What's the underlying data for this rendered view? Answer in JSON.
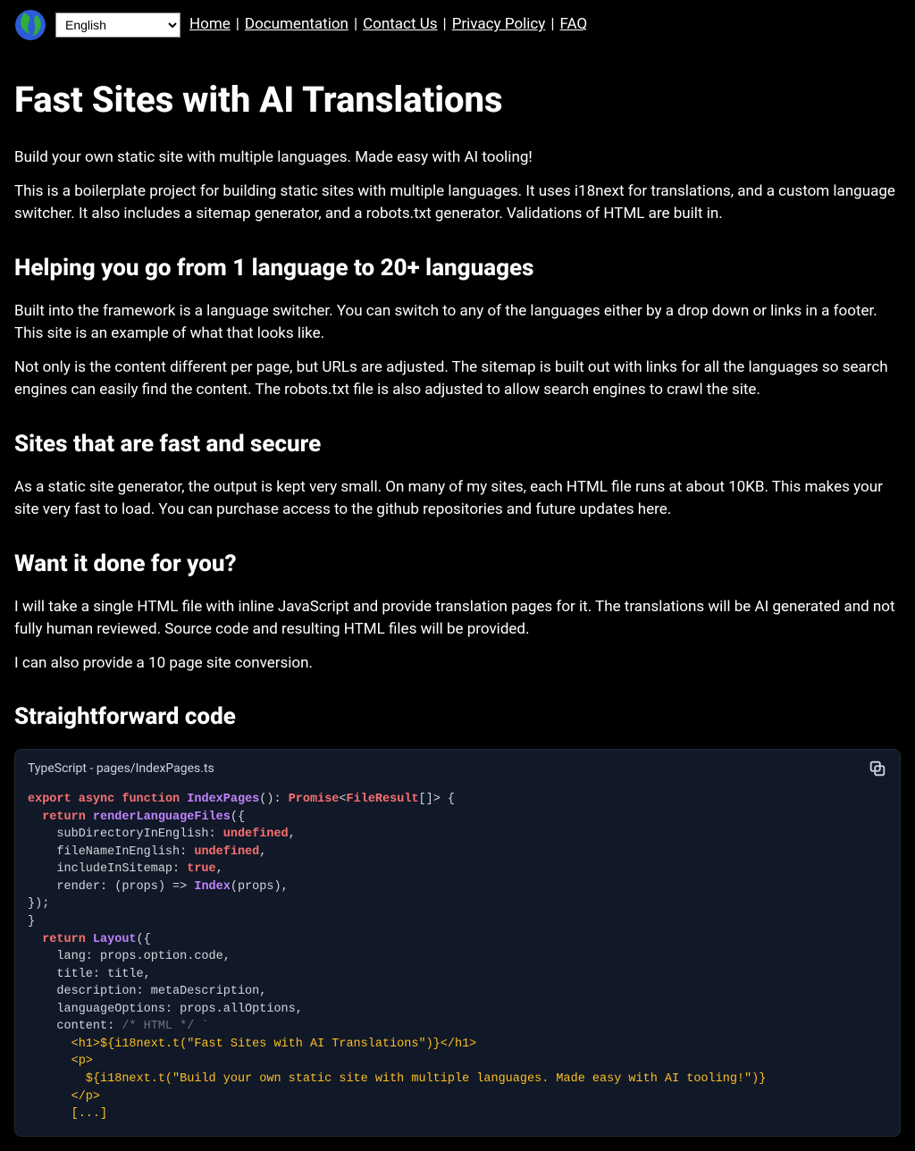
{
  "header": {
    "language_select": {
      "selected": "English"
    },
    "nav": {
      "home": "Home",
      "docs": "Documentation",
      "contact": "Contact Us",
      "privacy": "Privacy Policy",
      "faq": "FAQ"
    }
  },
  "main": {
    "title": "Fast Sites with AI Translations",
    "intro1": "Build your own static site with multiple languages. Made easy with AI tooling!",
    "intro2": "This is a boilerplate project for building static sites with multiple languages. It uses i18next for translations, and a custom language switcher. It also includes a sitemap generator, and a robots.txt generator. Validations of HTML are built in.",
    "h2_1": "Helping you go from 1 language to 20+ languages",
    "p1_1": "Built into the framework is a language switcher. You can switch to any of the languages either by a drop down or links in a footer. This site is an example of what that looks like.",
    "p1_2": "Not only is the content different per page, but URLs are adjusted. The sitemap is built out with links for all the languages so search engines can easily find the content. The robots.txt file is also adjusted to allow search engines to crawl the site.",
    "h2_2": "Sites that are fast and secure",
    "p2_1": "As a static site generator, the output is kept very small. On many of my sites, each HTML file runs at about 10KB. This makes your site very fast to load. You can purchase access to the github repositories and future updates here.",
    "h2_3": "Want it done for you?",
    "p3_1": "I will take a single HTML file with inline JavaScript and provide translation pages for it. The translations will be AI generated and not fully human reviewed. Source code and resulting HTML files will be provided.",
    "p3_2": "I can also provide a 10 page site conversion.",
    "h2_4": "Straightforward code"
  },
  "code": {
    "label": "TypeScript - pages/IndexPages.ts",
    "l1_kw1": "export",
    "l1_kw2": "async",
    "l1_kw3": "function",
    "l1_fn": "IndexPages",
    "l1_rest1": "(): ",
    "l1_typ1": "Promise",
    "l1_ang1": "<",
    "l1_typ2": "FileResult",
    "l1_rest2": "[]> {",
    "l2_kw": "return",
    "l2_fn": "renderLanguageFiles",
    "l2_rest": "({",
    "l3_a": "    subDirectoryInEnglish: ",
    "l3_val": "undefined",
    "l3_b": ",",
    "l4_a": "    fileNameInEnglish: ",
    "l4_val": "undefined",
    "l4_b": ",",
    "l5_a": "    includeInSitemap: ",
    "l5_val": "true",
    "l5_b": ",",
    "l6_a": "    render: (props) => ",
    "l6_fn": "Index",
    "l6_b": "(props),",
    "l7": "});",
    "l8": "}",
    "l9_kw": "return",
    "l9_fn": "Layout",
    "l9_rest": "({",
    "l10": "    lang: props.option.code,",
    "l11": "    title: title,",
    "l12": "    description: metaDescription,",
    "l13": "    languageOptions: props.allOptions,",
    "l14_a": "    content: ",
    "l14_cmt": "/* HTML */ `",
    "l15": "      <h1>${i18next.t(\"Fast Sites with AI Translations\")}</h1>",
    "l16": "      <p>",
    "l17": "        ${i18next.t(\"Build your own static site with multiple languages. Made easy with AI tooling!\")}",
    "l18": "      </p>",
    "l19": "      [...]"
  }
}
